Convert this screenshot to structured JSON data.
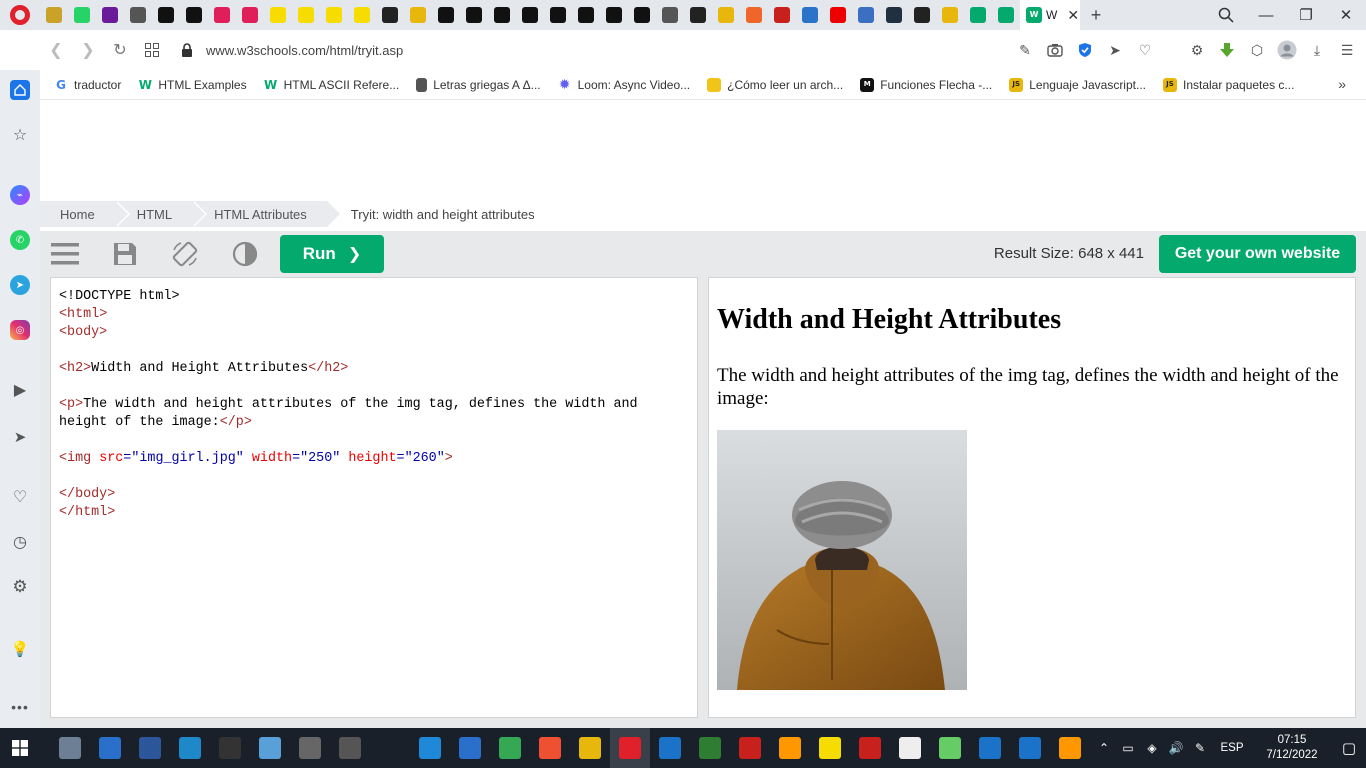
{
  "browser": {
    "active_tab_label": "W",
    "url": "www.w3schools.com/html/tryit.asp",
    "bookmarks": [
      {
        "label": "traductor",
        "icon": "google-icon",
        "color": "#4285f4",
        "glyph": "G"
      },
      {
        "label": "HTML Examples",
        "icon": "w3schools-icon",
        "color": "#04aa6d",
        "glyph": "W"
      },
      {
        "label": "HTML ASCII Refere...",
        "icon": "w3schools-icon",
        "color": "#04aa6d",
        "glyph": "W"
      },
      {
        "label": "Letras griegas A Δ...",
        "icon": "document-icon",
        "color": "#555555",
        "glyph": ""
      },
      {
        "label": "Loom: Async Video...",
        "icon": "loom-icon",
        "color": "#625df5",
        "glyph": "✹"
      },
      {
        "label": "¿Cómo leer un arch...",
        "icon": "js-icon",
        "color": "#f0c419",
        "glyph": ""
      },
      {
        "label": "Funciones Flecha -...",
        "icon": "m-icon",
        "color": "#111111",
        "glyph": "M"
      },
      {
        "label": "Lenguaje Javascript...",
        "icon": "js-icon",
        "color": "#e8b70c",
        "glyph": "JS"
      },
      {
        "label": "Instalar paquetes c...",
        "icon": "js-icon",
        "color": "#e8b70c",
        "glyph": "JS"
      }
    ]
  },
  "breadcrumb": [
    {
      "label": "Home"
    },
    {
      "label": "HTML"
    },
    {
      "label": "HTML Attributes"
    },
    {
      "label": "Tryit: width and height attributes"
    }
  ],
  "toolbar": {
    "run_label": "Run",
    "result_size": "Result Size: 648 x 441",
    "own_site_label": "Get your own website"
  },
  "editor": {
    "lines": [
      [
        {
          "t": "<!DOCTYPE html>",
          "c": ""
        }
      ],
      [
        {
          "t": "<",
          "c": "tg"
        },
        {
          "t": "html",
          "c": "tg"
        },
        {
          "t": ">",
          "c": "tg"
        }
      ],
      [
        {
          "t": "<body>",
          "c": "tg"
        }
      ],
      [],
      [
        {
          "t": "<h2>",
          "c": "tg"
        },
        {
          "t": "Width and Height Attributes",
          "c": ""
        },
        {
          "t": "</h2>",
          "c": "tg"
        }
      ],
      [],
      [
        {
          "t": "<p>",
          "c": "tg"
        },
        {
          "t": "The width and height attributes of the img tag, defines the width and",
          "c": ""
        }
      ],
      [
        {
          "t": "height of the image:",
          "c": ""
        },
        {
          "t": "</p>",
          "c": "tg"
        }
      ],
      [],
      [
        {
          "t": "<img ",
          "c": "tg"
        },
        {
          "t": "src",
          "c": "at"
        },
        {
          "t": "=\"img_girl.jpg\"",
          "c": "av"
        },
        {
          "t": " width",
          "c": "at"
        },
        {
          "t": "=\"250\"",
          "c": "av"
        },
        {
          "t": " height",
          "c": "at"
        },
        {
          "t": "=\"260\"",
          "c": "av"
        },
        {
          "t": ">",
          "c": "tg"
        }
      ],
      [],
      [
        {
          "t": "</body>",
          "c": "tg"
        }
      ],
      [
        {
          "t": "</html>",
          "c": "tg"
        }
      ]
    ]
  },
  "result": {
    "heading": "Width and Height Attributes",
    "paragraph": "The width and height attributes of the img tag, defines the width and height of the image:"
  },
  "taskbar": {
    "language": "ESP",
    "time": "07:15",
    "date": "7/12/2022"
  }
}
